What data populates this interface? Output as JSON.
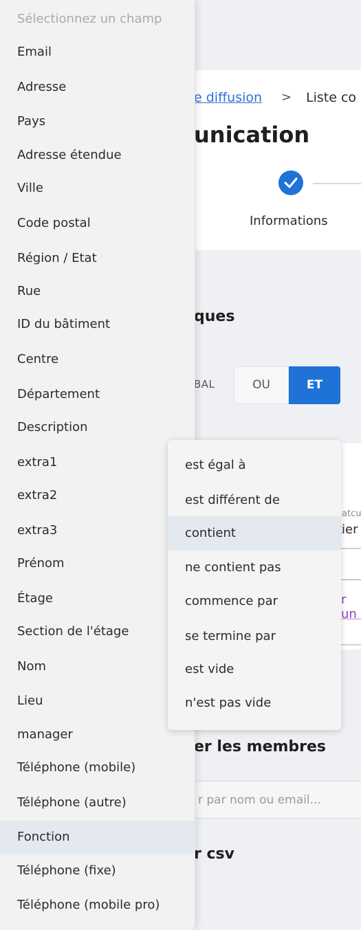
{
  "breadcrumb": {
    "link_text": "e diffusion",
    "separator": ">",
    "current": "Liste co"
  },
  "page_title": "unication",
  "stepper": {
    "step1_label": "Informations"
  },
  "sections": {
    "rules_title": "ques",
    "members_title": "er les membres",
    "csv_title": "r csv"
  },
  "logic": {
    "global_label": "BAL",
    "or_label": "OU",
    "and_label": "ET",
    "selected": "ET"
  },
  "rule": {
    "small_label": "atcu",
    "value_text": "tier",
    "purple_text": "r un"
  },
  "members_search": {
    "placeholder": "r par nom ou email..."
  },
  "field_dropdown": {
    "placeholder": "Sélectionnez un champ",
    "selected": "Fonction",
    "options": [
      "Email",
      "Adresse",
      "Pays",
      "Adresse étendue",
      "Ville",
      "Code postal",
      "Région / Etat",
      "Rue",
      "ID du bâtiment",
      "Centre",
      "Département",
      "Description",
      "extra1",
      "extra2",
      "extra3",
      "Prénom",
      "Étage",
      "Section de l'étage",
      "Nom",
      "Lieu",
      "manager",
      "Téléphone (mobile)",
      "Téléphone (autre)",
      "Fonction",
      "Téléphone (fixe)",
      "Téléphone (mobile pro)"
    ]
  },
  "operator_dropdown": {
    "highlighted": "contient",
    "options": [
      "est égal à",
      "est différent de",
      "contient",
      "ne contient pas",
      "commence par",
      "se termine par",
      "est vide",
      "n'est pas vide"
    ]
  },
  "colors": {
    "accent": "#1f72d6",
    "purple": "#8b3fc4",
    "menu_bg": "#f2f2f2",
    "selected_bg": "#e4e9f0"
  }
}
